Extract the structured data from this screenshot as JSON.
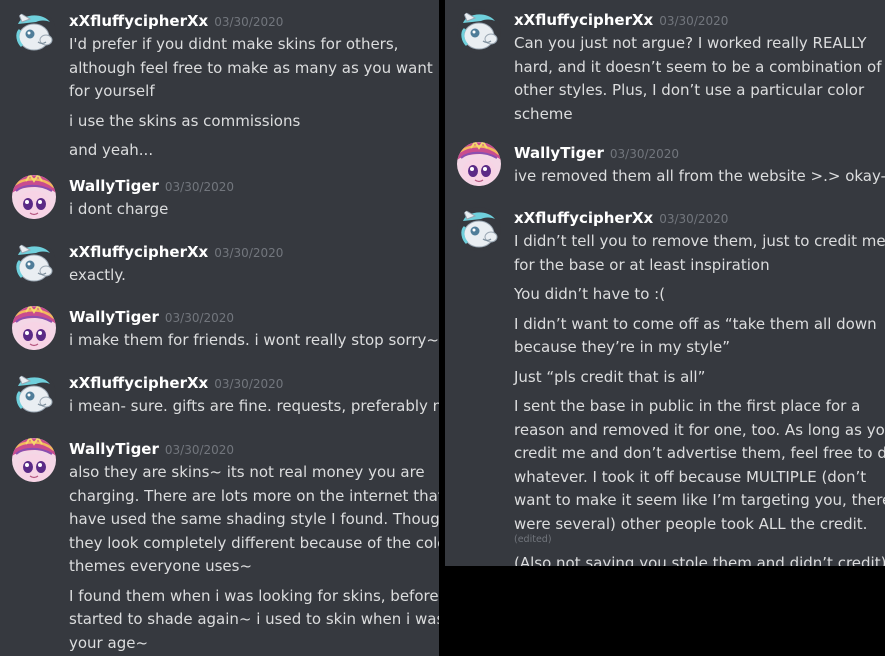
{
  "colors": {
    "background": "#36393f",
    "outer": "#000000",
    "author": "#ffffff",
    "timestamp": "#72767d",
    "text": "#dcddde"
  },
  "left": {
    "messages": [
      {
        "author": "xXfluffycipherXx",
        "avatar": "pony-avatar-silver",
        "time": "03/30/2020",
        "lines": [
          "I'd prefer if you didnt make skins for others,",
          "although feel free to make as many as you want",
          "for yourself",
          "",
          "i use the skins as commissions",
          "",
          "and yeah..."
        ]
      },
      {
        "author": "WallyTiger",
        "avatar": "pony-avatar-pink",
        "time": "03/30/2020",
        "lines": [
          "i dont charge"
        ]
      },
      {
        "author": "xXfluffycipherXx",
        "avatar": "pony-avatar-silver",
        "time": "03/30/2020",
        "lines": [
          "exactly."
        ]
      },
      {
        "author": "WallyTiger",
        "avatar": "pony-avatar-pink",
        "time": "03/30/2020",
        "lines": [
          "i make them for friends. i wont really stop sorry~"
        ]
      },
      {
        "author": "xXfluffycipherXx",
        "avatar": "pony-avatar-silver",
        "time": "03/30/2020",
        "lines": [
          "i mean- sure. gifts are fine. requests, preferably no."
        ]
      },
      {
        "author": "WallyTiger",
        "avatar": "pony-avatar-pink",
        "time": "03/30/2020",
        "lines": [
          "also they are skins~ its not real money you are",
          "charging. There are lots more on the internet that",
          "have used the same shading style I found. Though",
          "they look completely different because of the color",
          "themes everyone uses~",
          "",
          "I found them when i was looking for skins, before i",
          "started to shade again~ i used to skin when i was",
          "your age~"
        ]
      }
    ]
  },
  "right": {
    "messages": [
      {
        "author": "xXfluffycipherXx",
        "avatar": "pony-avatar-silver",
        "time": "03/30/2020",
        "lines": [
          "Can you just not argue? I worked really REALLY",
          "hard, and it doesn’t seem to be a combination of",
          "other styles. Plus, I don’t use a particular color",
          "scheme"
        ]
      },
      {
        "author": "WallyTiger",
        "avatar": "pony-avatar-pink",
        "time": "03/30/2020",
        "lines": [
          "ive removed them all from the website >.> okay-?"
        ]
      },
      {
        "author": "xXfluffycipherXx",
        "avatar": "pony-avatar-silver",
        "time": "03/30/2020",
        "lines": [
          "I didn’t tell you to remove them, just to credit me",
          "for the base or at least inspiration",
          "",
          "You didn’t have to :(",
          "",
          "I didn’t want to come off as “take them all down",
          "because they’re in my style”",
          "",
          "Just “pls credit that is all”",
          "",
          "I sent the base in public in the first place for a",
          "reason and removed it for one, too. As long as you",
          "credit me and don’t advertise them, feel free to do",
          "whatever. I took it off because MULTIPLE (don’t",
          "want to make it seem like I’m targeting you, there",
          "were several) other people took ALL the credit."
        ],
        "edited": "(edited)",
        "after_lines": [
          "(Also not saying you stole them and didn’t credit)"
        ]
      }
    ]
  }
}
